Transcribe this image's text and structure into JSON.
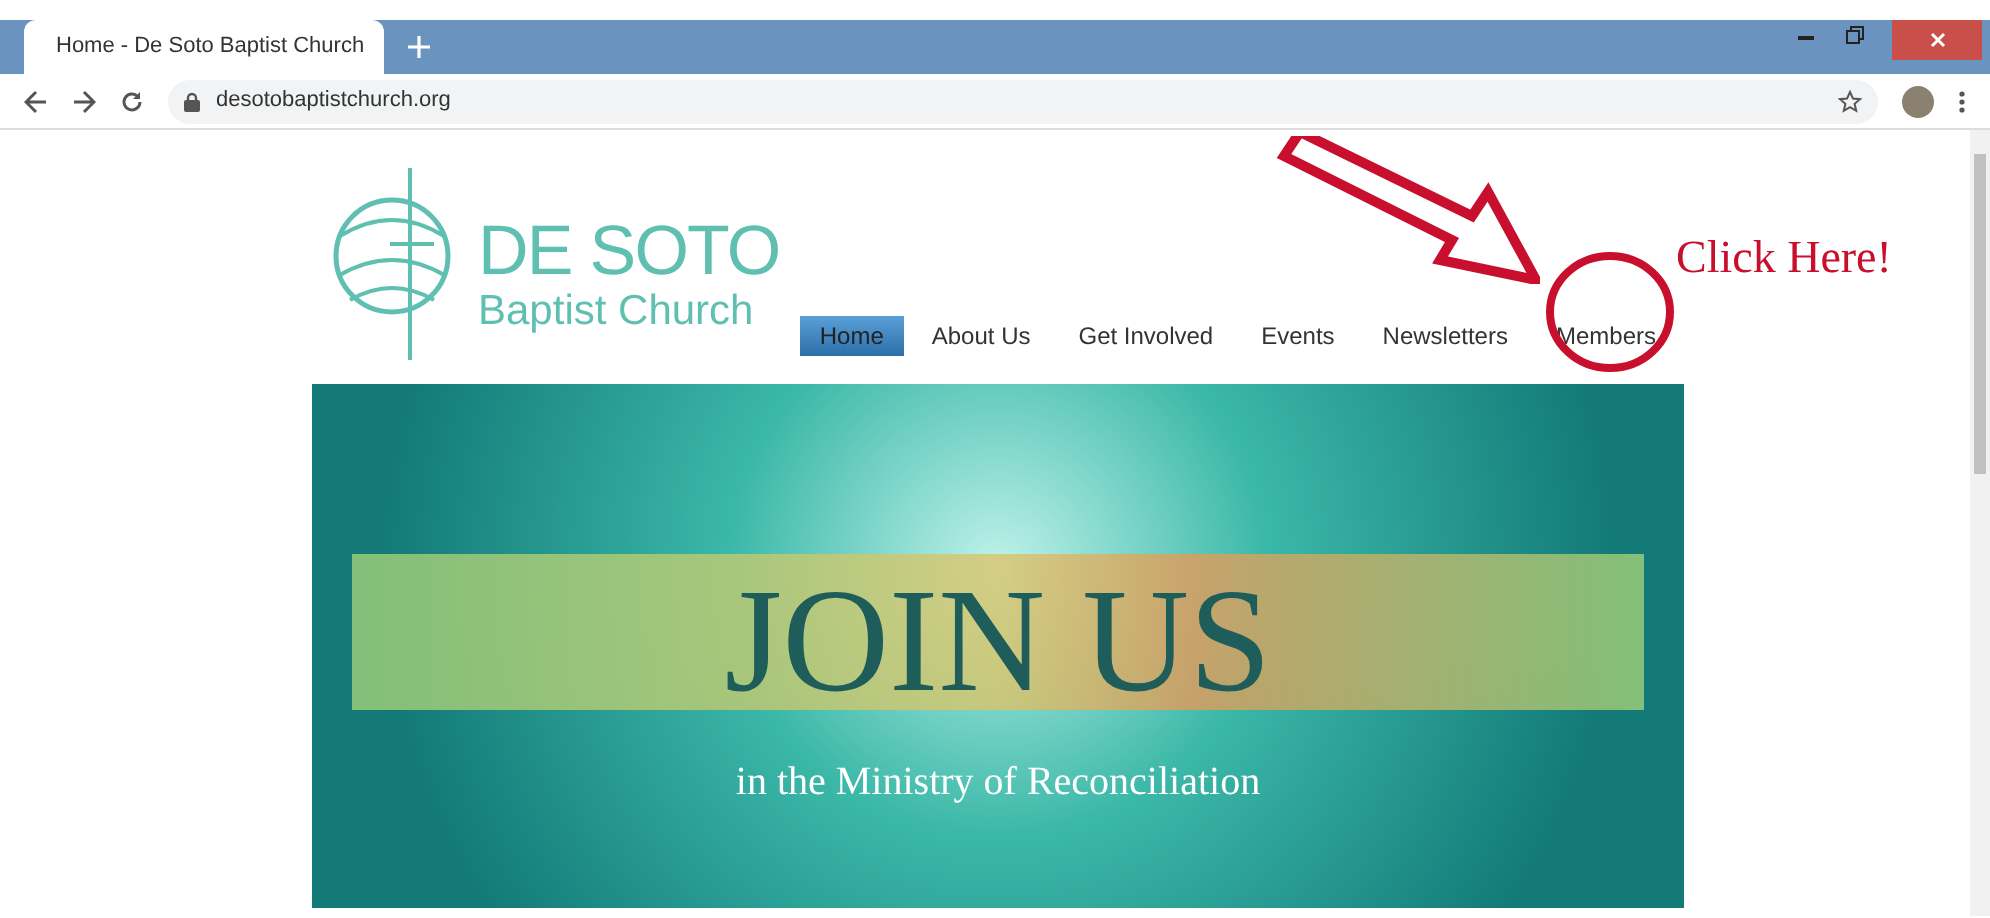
{
  "browser": {
    "tab_title": "Home - De Soto Baptist Church",
    "url": "desotobaptistchurch.org"
  },
  "site": {
    "logo_title": "DE SOTO",
    "logo_subtitle": "Baptist Church",
    "nav": [
      {
        "label": "Home",
        "selected": true
      },
      {
        "label": "About Us",
        "selected": false
      },
      {
        "label": "Get Involved",
        "selected": false
      },
      {
        "label": "Events",
        "selected": false
      },
      {
        "label": "Newsletters",
        "selected": false
      },
      {
        "label": "Members",
        "selected": false
      }
    ],
    "banner": {
      "heading": "JOIN US",
      "subheading": "in the Ministry of Reconciliation"
    }
  },
  "annotation": {
    "text": "Click Here!"
  }
}
